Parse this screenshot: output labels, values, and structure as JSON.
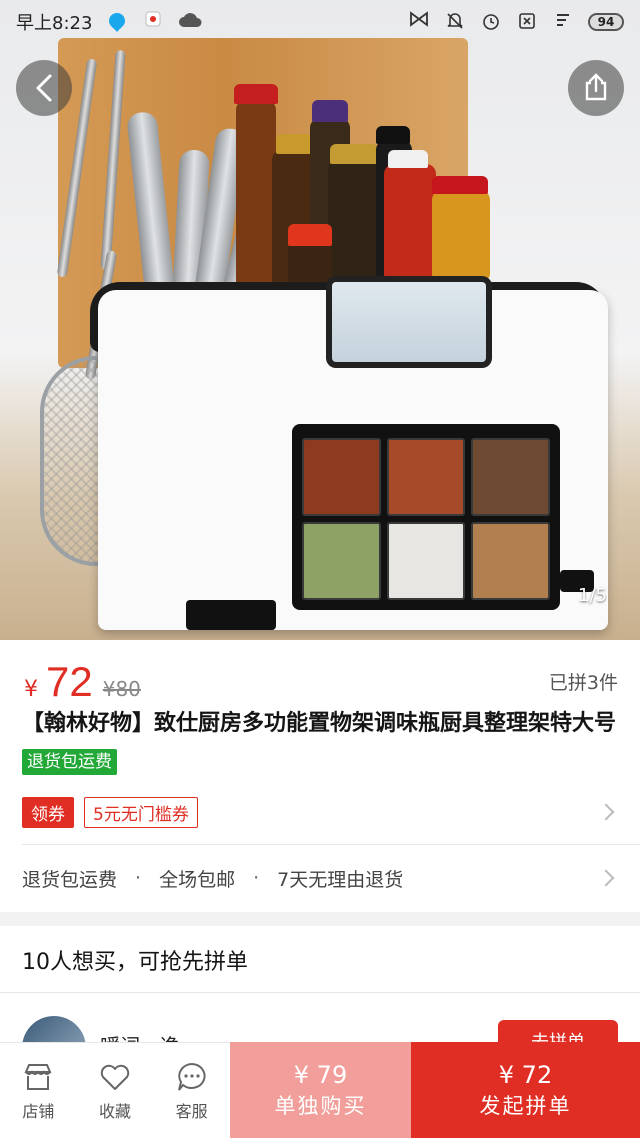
{
  "status_bar": {
    "time": "早上8:23",
    "battery": "94",
    "icons": [
      "bubble-icon",
      "app-icon",
      "cloud-icon",
      "bow-icon",
      "mute-icon",
      "alarm-icon",
      "sim-icon",
      "signal-icon"
    ]
  },
  "gallery": {
    "counter": "1/5",
    "description_icons": [
      "back-icon",
      "share-icon"
    ]
  },
  "product": {
    "price_symbol": "¥",
    "price": "72",
    "original_price": "¥80",
    "sold": "已拼3件",
    "title": "【翰林好物】致仕厨房多功能置物架调味瓶厨具整理架特大号",
    "title_tag": "退货包运费",
    "coupon_button": "领券",
    "coupon_text": "5元无门槛券",
    "services": [
      "退货包运费",
      "全场包邮",
      "7天无理由退货"
    ],
    "service_separator": "·"
  },
  "group": {
    "title": "10人想买，可抢先拼单",
    "user_name": "嗳词一逸",
    "join_button": "去拼单"
  },
  "bottom_bar": {
    "shop": "店铺",
    "favorite": "收藏",
    "service": "客服",
    "solo_price": "¥ 79",
    "solo_label": "单独购买",
    "group_price": "¥ 72",
    "group_label": "发起拼单"
  },
  "colors": {
    "accent": "#e02e24",
    "green_tag": "#22a836",
    "solo_button": "#f29e9a"
  }
}
